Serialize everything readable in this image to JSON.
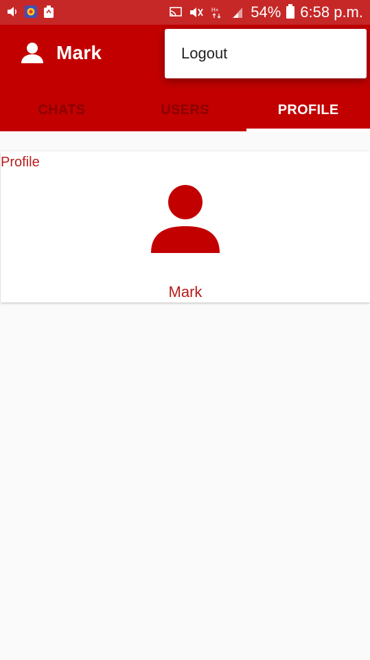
{
  "status_bar": {
    "battery": "54%",
    "time": "6:58 p.m.",
    "icons": [
      "volume-icon",
      "app-notification-icon",
      "recycle-icon",
      "cast-icon",
      "mute-icon",
      "network-hplus-icon",
      "signal-icon",
      "battery-icon"
    ]
  },
  "app_bar": {
    "title": "Mark",
    "icon": "user-icon",
    "color": "#c20000"
  },
  "tabs": [
    {
      "label": "CHATS",
      "active": false
    },
    {
      "label": "USERS",
      "active": false
    },
    {
      "label": "PROFILE",
      "active": true
    }
  ],
  "menu": {
    "items": [
      "Logout"
    ]
  },
  "profile_card": {
    "title": "Profile",
    "avatar_icon": "person-icon",
    "name": "Mark"
  }
}
